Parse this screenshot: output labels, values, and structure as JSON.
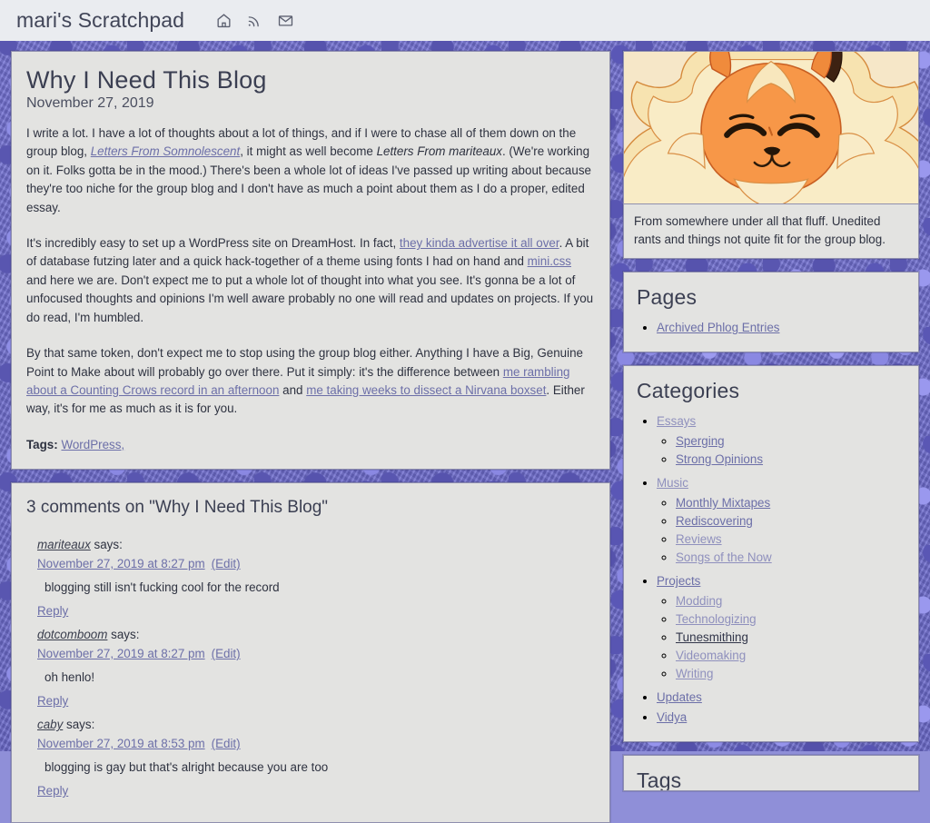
{
  "header": {
    "site_title": "mari's Scratchpad",
    "nav_icons": [
      {
        "name": "home-icon",
        "label": "Home"
      },
      {
        "name": "rss-icon",
        "label": "RSS Feed"
      },
      {
        "name": "mail-icon",
        "label": "Email"
      }
    ]
  },
  "article": {
    "title": "Why I Need This Blog",
    "date": "November 27, 2019",
    "p1": {
      "a": "I write a lot. I have a lot of thoughts about a lot of things, and if I were to chase all of them down on the group blog, ",
      "link1": "Letters From Somnolescent",
      "b": ", it might as well become ",
      "em1": "Letters From mariteaux",
      "c": ". (We're working on it. Folks gotta be in the mood.) There's been a whole lot of ideas I've passed up writing about because they're too niche for the group blog and I don't have as much a point about them as I do a proper, edited essay."
    },
    "p2": {
      "a": "It's incredibly easy to set up a WordPress site on DreamHost. In fact, ",
      "link1": "they kinda advertise it all over",
      "b": ". A bit of database futzing later and a quick hack-together of a theme using fonts I had on hand and ",
      "link2": "mini.css",
      "c": " and here we are. Don't expect me to put a whole lot of thought into what you see. It's gonna be a lot of unfocused thoughts and opinions I'm well aware probably no one will read and updates on projects. If you do read, I'm humbled."
    },
    "p3": {
      "a": "By that same token, don't expect me to stop using the group blog either. Anything I have a Big, Genuine Point to Make about will probably go over there. Put it simply: it's the difference between ",
      "link1": "me rambling about a Counting Crows record in an afternoon",
      "b": " and ",
      "link2": "me taking weeks to dissect a Nirvana boxset",
      "c": ". Either way, it's for me as much as it is for you."
    },
    "tags_label": "Tags:",
    "tags": [
      "WordPress,"
    ]
  },
  "comments": {
    "heading": "3 comments on \"Why I Need This Blog\"",
    "says_suffix": "says:",
    "edit_label": "(Edit)",
    "reply_label": "Reply",
    "items": [
      {
        "author": "mariteaux",
        "timestamp": "November 27, 2019 at 8:27 pm",
        "text": "blogging still isn't fucking cool for the record"
      },
      {
        "author": "dotcomboom",
        "timestamp": "November 27, 2019 at 8:27 pm",
        "text": "oh henlo!"
      },
      {
        "author": "caby",
        "timestamp": "November 27, 2019 at 8:53 pm",
        "text": "blogging is gay but that's alright because you are too"
      }
    ]
  },
  "sidebar": {
    "image_caption": "From somewhere under all that fluff. Unedited rants and things not quite fit for the group blog.",
    "pages": {
      "title": "Pages",
      "items": [
        {
          "label": "Archived Phlog Entries",
          "visited": false
        }
      ]
    },
    "categories": {
      "title": "Categories",
      "items": [
        {
          "label": "Essays",
          "visited": true,
          "children": [
            {
              "label": "Sperging",
              "visited": false
            },
            {
              "label": "Strong Opinions",
              "visited": false
            }
          ]
        },
        {
          "label": "Music",
          "visited": true,
          "children": [
            {
              "label": "Monthly Mixtapes",
              "visited": false
            },
            {
              "label": "Rediscovering",
              "visited": false
            },
            {
              "label": "Reviews",
              "visited": true
            },
            {
              "label": "Songs of the Now",
              "visited": true
            }
          ]
        },
        {
          "label": "Projects",
          "visited": false,
          "children": [
            {
              "label": "Modding",
              "visited": true
            },
            {
              "label": "Technologizing",
              "visited": true
            },
            {
              "label": "Tunesmithing",
              "visited": false,
              "hovered": true
            },
            {
              "label": "Videomaking",
              "visited": true
            },
            {
              "label": "Writing",
              "visited": true
            }
          ]
        },
        {
          "label": "Updates",
          "visited": false,
          "children": []
        },
        {
          "label": "Vidya",
          "visited": false,
          "children": []
        }
      ]
    },
    "tags_widget": {
      "title": "Tags"
    }
  },
  "colors": {
    "background_purple": "#6f6fcf",
    "panel": "#e3e3e1",
    "header_bar": "#eaecf0",
    "link": "#6c6fa8",
    "link_visited": "#8f90bd",
    "text": "#2e3240"
  }
}
